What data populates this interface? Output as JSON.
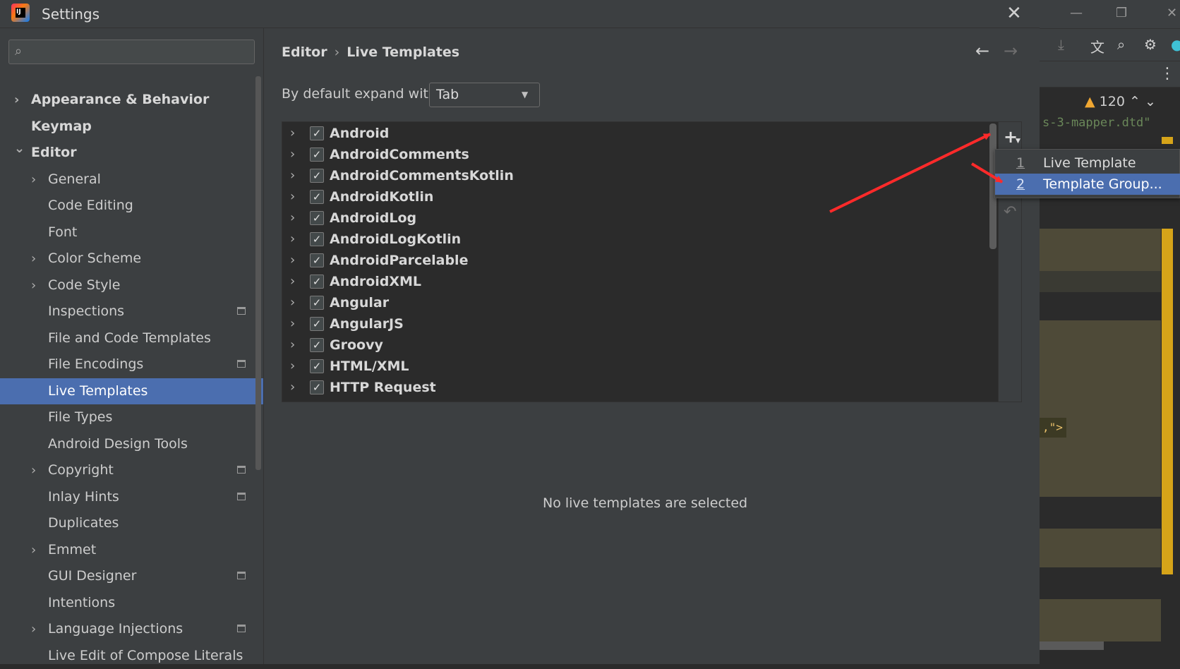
{
  "window": {
    "title": "Settings",
    "logo_text": "IJ"
  },
  "ide_background": {
    "code_text": "s-3-mapper.dtd\"",
    "warning_count": "120",
    "snippet_text": ",\">",
    "accent_color": "#d6a419"
  },
  "sidebar": {
    "search_placeholder": "",
    "items": [
      {
        "label": "Appearance & Behavior",
        "bold": true,
        "chevron": "right",
        "level": 0
      },
      {
        "label": "Keymap",
        "bold": true,
        "chevron": "",
        "level": 0
      },
      {
        "label": "Editor",
        "bold": true,
        "chevron": "down",
        "level": 0
      },
      {
        "label": "General",
        "chevron": "right",
        "level": 1
      },
      {
        "label": "Code Editing",
        "chevron": "",
        "level": 1
      },
      {
        "label": "Font",
        "chevron": "",
        "level": 1
      },
      {
        "label": "Color Scheme",
        "chevron": "right",
        "level": 1
      },
      {
        "label": "Code Style",
        "chevron": "right",
        "level": 1
      },
      {
        "label": "Inspections",
        "chevron": "",
        "level": 1,
        "project_icon": true
      },
      {
        "label": "File and Code Templates",
        "chevron": "",
        "level": 1
      },
      {
        "label": "File Encodings",
        "chevron": "",
        "level": 1,
        "project_icon": true
      },
      {
        "label": "Live Templates",
        "chevron": "",
        "level": 1,
        "selected": true
      },
      {
        "label": "File Types",
        "chevron": "",
        "level": 1
      },
      {
        "label": "Android Design Tools",
        "chevron": "",
        "level": 1
      },
      {
        "label": "Copyright",
        "chevron": "right",
        "level": 1,
        "project_icon": true
      },
      {
        "label": "Inlay Hints",
        "chevron": "",
        "level": 1,
        "project_icon": true
      },
      {
        "label": "Duplicates",
        "chevron": "",
        "level": 1
      },
      {
        "label": "Emmet",
        "chevron": "right",
        "level": 1
      },
      {
        "label": "GUI Designer",
        "chevron": "",
        "level": 1,
        "project_icon": true
      },
      {
        "label": "Intentions",
        "chevron": "",
        "level": 1
      },
      {
        "label": "Language Injections",
        "chevron": "right",
        "level": 1,
        "project_icon": true
      },
      {
        "label": "Live Edit of Compose Literals",
        "chevron": "",
        "level": 1
      }
    ],
    "selected_color": "#4b6eaf"
  },
  "main": {
    "breadcrumb": {
      "parent": "Editor",
      "separator": "›",
      "current": "Live Templates"
    },
    "expand_label": "By default expand with",
    "expand_value": "Tab",
    "templates": [
      {
        "label": "Android",
        "checked": true
      },
      {
        "label": "AndroidComments",
        "checked": true
      },
      {
        "label": "AndroidCommentsKotlin",
        "checked": true
      },
      {
        "label": "AndroidKotlin",
        "checked": true
      },
      {
        "label": "AndroidLog",
        "checked": true
      },
      {
        "label": "AndroidLogKotlin",
        "checked": true
      },
      {
        "label": "AndroidParcelable",
        "checked": true
      },
      {
        "label": "AndroidXML",
        "checked": true
      },
      {
        "label": "Angular",
        "checked": true
      },
      {
        "label": "AngularJS",
        "checked": true
      },
      {
        "label": "Groovy",
        "checked": true
      },
      {
        "label": "HTML/XML",
        "checked": true
      },
      {
        "label": "HTTP Request",
        "checked": true
      }
    ],
    "empty_message": "No live templates are selected"
  },
  "popup_menu": {
    "items": [
      {
        "number": "1",
        "label": "Live Template",
        "active": false
      },
      {
        "number": "2",
        "label": "Template Group...",
        "active": true
      }
    ]
  },
  "annotation": {
    "arrow_color": "#ff2a2a"
  }
}
